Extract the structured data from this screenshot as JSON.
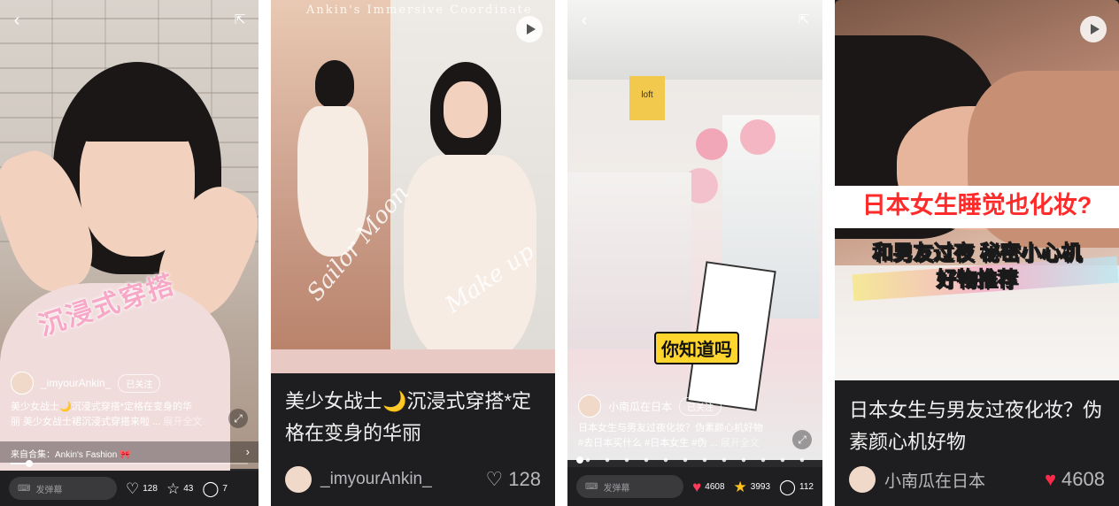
{
  "panel1": {
    "overlay_caption": "沉浸式穿搭",
    "author": "_imyourAnkin_",
    "follow_label": "已关注",
    "description_line1": "美少女战士🌙沉浸式穿搭*定格在变身的华",
    "description_line2": "丽 美少女战士裙沉浸式穿搭来啦 ...",
    "more_label": "展开全文",
    "collection_label": "来自合集：Ankin's Fashion 🎀",
    "progress": 0.08,
    "danmaku_placeholder": "发弹幕",
    "likes": "128",
    "favorites": "43",
    "comments": "7"
  },
  "panel2": {
    "banner_text": "Ankin's Immersive Coordinate",
    "script_left": "Sailor Moon",
    "script_right": "Make up",
    "title": "美少女战士🌙沉浸式穿搭*定格在变身的华丽",
    "author": "_imyourAnkin_",
    "likes": "128"
  },
  "panel3": {
    "store_sign": "loft",
    "tag_text": "你知道吗",
    "author": "小南瓜在日本",
    "follow_label": "已关注",
    "description_line1": "日本女生与男友过夜化妆？伪素颜心机好物",
    "description_line2": "#去日本买什么 #日本女生 #伪 ...",
    "more_label": "展开全文",
    "danmaku_placeholder": "发弹幕",
    "likes": "4608",
    "favorites": "3993",
    "comments": "112"
  },
  "panel4": {
    "headline": "日本女生睡觉也化妆?",
    "subline1": "和男友过夜 秘密小心机",
    "subline2": "好物推荐",
    "title": "日本女生与男友过夜化妆？伪素颜心机好物",
    "author": "小南瓜在日本",
    "likes": "4608"
  }
}
